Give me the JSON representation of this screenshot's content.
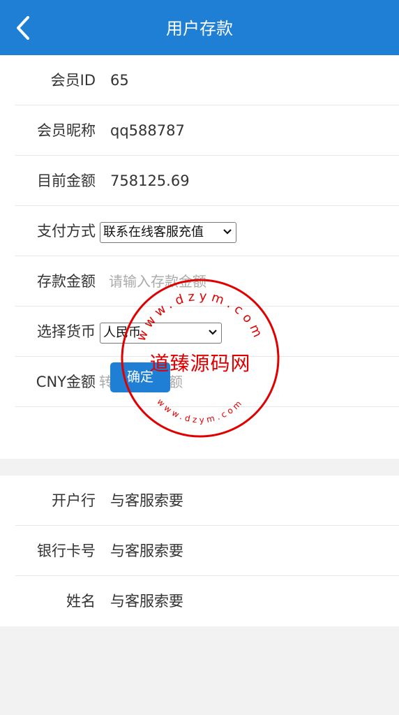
{
  "header": {
    "title": "用户存款"
  },
  "deposit_form": {
    "member_id": {
      "label": "会员ID",
      "value": "65"
    },
    "nickname": {
      "label": "会员昵称",
      "value": "qq588787"
    },
    "balance": {
      "label": "目前金额",
      "value": "758125.69"
    },
    "payment_method": {
      "label": "支付方式",
      "selected": "联系在线客服充值"
    },
    "deposit_amount": {
      "label": "存款金额",
      "placeholder": "请输入存款金额"
    },
    "currency": {
      "label": "选择货币",
      "selected": "人民币"
    },
    "cny_amount": {
      "label": "CNY金额",
      "placeholder": "转换后的金额"
    },
    "confirm_label": "确定"
  },
  "bank_info": {
    "bank": {
      "label": "开户行",
      "value": "与客服索要"
    },
    "card_number": {
      "label": "银行卡号",
      "value": "与客服索要"
    },
    "name": {
      "label": "姓名",
      "value": "与客服索要"
    }
  },
  "watermark": {
    "text": "道臻源码网",
    "ring_top": "www.dzym.com",
    "ring_bottom": "www.dzym.com"
  },
  "colors": {
    "header_bg": "#1e7fd4",
    "button_bg": "#1e7fd4",
    "stamp": "#e00000"
  }
}
